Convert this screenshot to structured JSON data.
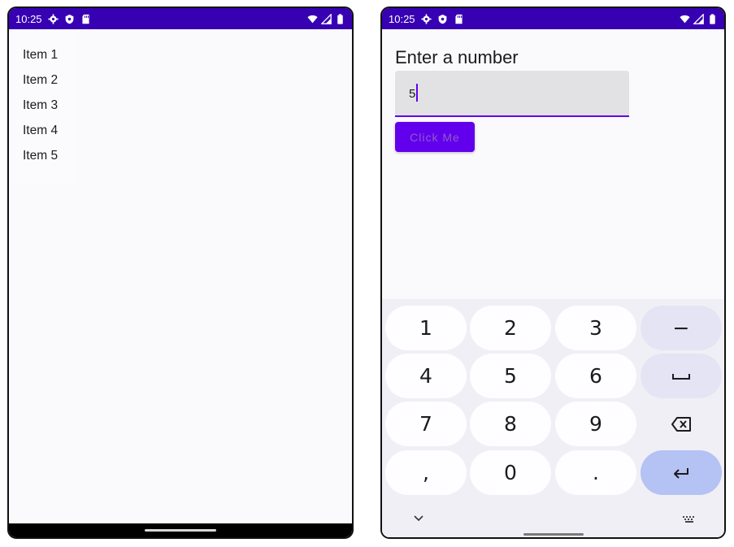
{
  "left_phone": {
    "status_time": "10:25",
    "list_items": [
      "Item 1",
      "Item 2",
      "Item 3",
      "Item 4",
      "Item 5"
    ]
  },
  "right_phone": {
    "status_time": "10:25",
    "form": {
      "title": "Enter a number",
      "input_value": "5",
      "button_label": "Click Me"
    },
    "keyboard": {
      "rows": [
        [
          "1",
          "2",
          "3",
          "−"
        ],
        [
          "4",
          "5",
          "6",
          "space-icon"
        ],
        [
          "7",
          "8",
          "9",
          "backspace-icon"
        ],
        [
          ",",
          "0",
          ".",
          "enter-icon"
        ]
      ]
    }
  },
  "colors": {
    "status_bar": "#3700b3",
    "primary": "#6200ee",
    "enter_key": "#b4c2f4"
  }
}
